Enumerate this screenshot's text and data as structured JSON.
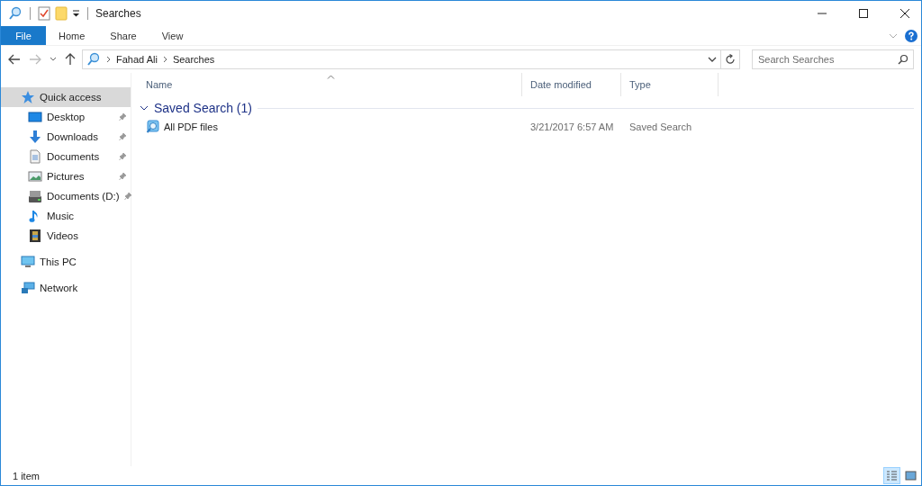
{
  "window": {
    "title": "Searches"
  },
  "ribbon_tabs": [
    {
      "label": "File",
      "kind": "file",
      "selected": false
    },
    {
      "label": "Home",
      "kind": "tab",
      "selected": false
    },
    {
      "label": "Share",
      "kind": "tab",
      "selected": false
    },
    {
      "label": "View",
      "kind": "tab",
      "selected": false
    }
  ],
  "address_bar": {
    "crumbs": [
      "Fahad Ali",
      "Searches"
    ]
  },
  "search": {
    "placeholder": "Search Searches"
  },
  "sidebar": {
    "items": [
      {
        "label": "Quick access",
        "kind": "star",
        "selected": true,
        "pinned": false,
        "children": [
          {
            "label": "Desktop",
            "kind": "desktop",
            "selected": false,
            "pinned": true
          },
          {
            "label": "Downloads",
            "kind": "download",
            "selected": false,
            "pinned": true
          },
          {
            "label": "Documents",
            "kind": "document",
            "selected": false,
            "pinned": true
          },
          {
            "label": "Pictures",
            "kind": "pictures",
            "selected": false,
            "pinned": true
          },
          {
            "label": "Documents (D:)",
            "kind": "drive",
            "selected": false,
            "pinned": true
          },
          {
            "label": "Music",
            "kind": "music",
            "selected": false,
            "pinned": false
          },
          {
            "label": "Videos",
            "kind": "video",
            "selected": false,
            "pinned": false
          }
        ]
      },
      {
        "label": "This PC",
        "kind": "pc",
        "selected": false,
        "pinned": false
      },
      {
        "label": "Network",
        "kind": "network",
        "selected": false,
        "pinned": false
      }
    ]
  },
  "table": {
    "columns": [
      "Name",
      "Date modified",
      "Type"
    ],
    "groups": [
      {
        "title": "Saved Search (1)",
        "expanded": true,
        "rows": [
          {
            "name": "All PDF files",
            "date": "3/21/2017 6:57 AM",
            "type": "Saved Search"
          }
        ]
      }
    ]
  },
  "status_bar": {
    "text": "1 item",
    "views": [
      {
        "kind": "details",
        "selected": true
      },
      {
        "kind": "large",
        "selected": false
      }
    ]
  }
}
